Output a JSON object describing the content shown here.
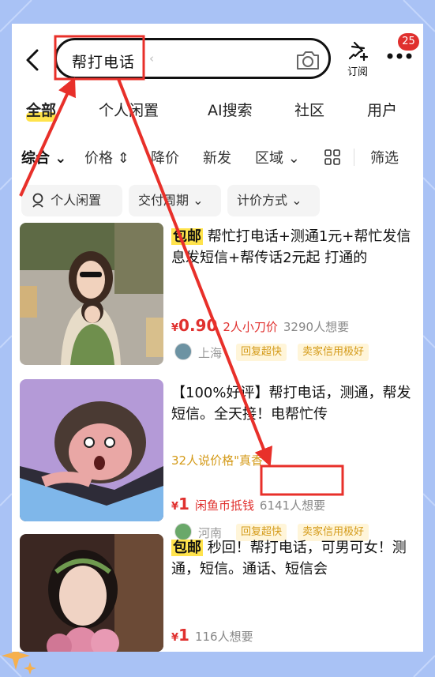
{
  "header": {
    "search_query": "帮打电话",
    "subscribe_label": "订阅",
    "notification_count": "25"
  },
  "tabs": [
    {
      "label": "全部",
      "active": true
    },
    {
      "label": "个人闲置"
    },
    {
      "label": "AI搜索"
    },
    {
      "label": "社区"
    },
    {
      "label": "用户"
    }
  ],
  "filters": {
    "sort": "综合",
    "price": "价格",
    "price_drop": "降价",
    "new": "新发",
    "region": "区域",
    "filter": "筛选"
  },
  "chips": [
    "个人闲置",
    "交付周期",
    "计价方式"
  ],
  "listings": [
    {
      "badge": "包邮",
      "title": "帮忙打电话+测通1元+帮忙发信息发短信+帮传话2元起 打通的",
      "currency": "¥",
      "price": "0.90",
      "price_note": "2人小刀价",
      "wants": "3290人想要",
      "city": "上海",
      "tags": [
        "回复超快",
        "卖家信用极好"
      ]
    },
    {
      "title": "【100%好评】帮打电话，测通，帮发短信。全天接！电帮忙传",
      "quote": "32人说价格\"真香\"",
      "currency": "¥",
      "price": "1",
      "price_note": "闲鱼币抵钱",
      "wants": "6141人想要",
      "city": "河南",
      "tags": [
        "回复超快",
        "卖家信用极好"
      ]
    },
    {
      "badge": "包邮",
      "title": "秒回！帮打电话，可男可女！测通，短信。通话、短信会",
      "currency": "¥",
      "price": "1",
      "wants": "116人想要"
    }
  ],
  "colors": {
    "accent_yellow": "#ffe34c",
    "price_red": "#e0302e",
    "annotation_red": "#e8302a",
    "background_blue": "#a9c2f5"
  }
}
